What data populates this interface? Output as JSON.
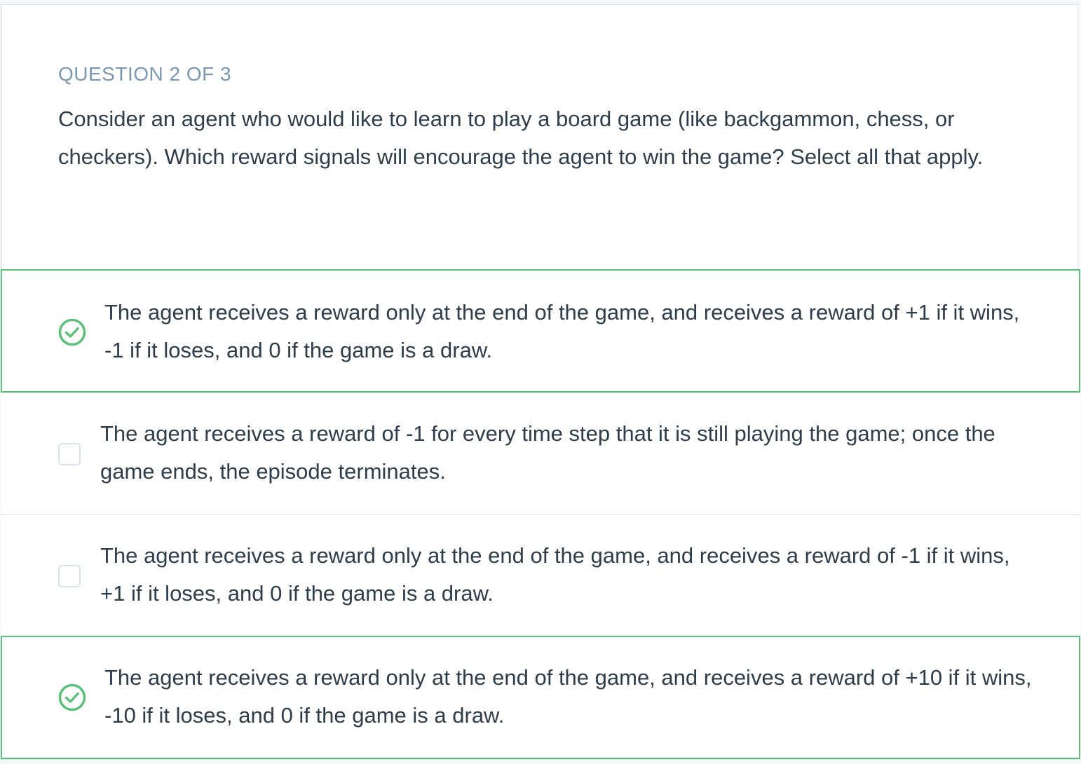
{
  "question": {
    "label": "QUESTION 2 OF 3",
    "prompt": "Consider an agent who would like to learn to play a board game (like backgammon, chess, or checkers). Which reward signals will encourage the agent to win the game? Select all that apply."
  },
  "options": [
    {
      "text": "The agent receives a reward only at the end of the game, and receives a reward of +1 if it wins, -1 if it loses, and 0 if the game is a draw.",
      "state": "correct",
      "icon": "check-circle-icon"
    },
    {
      "text": "The agent receives a reward of -1 for every time step that it is still playing the game; once the game ends, the episode terminates.",
      "state": "unchecked",
      "icon": "checkbox"
    },
    {
      "text": "The agent receives a reward only at the end of the game, and receives a reward of -1 if it wins, +1 if it loses, and 0 if the game is a draw.",
      "state": "unchecked",
      "icon": "checkbox"
    },
    {
      "text": "The agent receives a reward only at the end of the game, and receives a reward of +10 if it wins, -10 if it loses, and 0 if the game is a draw.",
      "state": "correct",
      "icon": "check-circle-icon"
    }
  ],
  "colors": {
    "correct": "#5cbf7c",
    "label": "#7d97ad",
    "text": "#2e3d49",
    "border": "#dbe2e8"
  }
}
